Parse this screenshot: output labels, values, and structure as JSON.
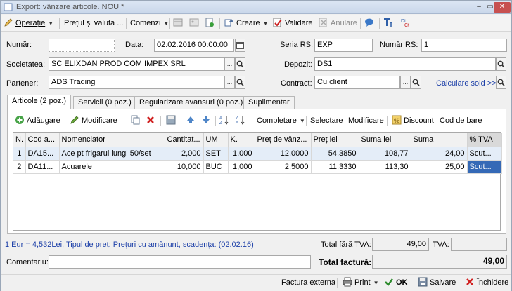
{
  "window": {
    "title": "Export: vânzare articole. NOU *",
    "min": "–",
    "max": "▭",
    "close": "✕"
  },
  "toolbar": {
    "operatie": "Operație",
    "pret_valuta": "Prețul și valuta ...",
    "comenzi": "Comenzi",
    "creare": "Creare",
    "validare": "Validare",
    "anulare": "Anulare"
  },
  "form": {
    "numar_label": "Număr:",
    "numar_value": "",
    "data_label": "Data:",
    "data_value": "02.02.2016 00:00:00",
    "seria_label": "Seria RS:",
    "seria_value": "EXP",
    "numar_rs_label": "Număr RS:",
    "numar_rs_value": "1",
    "societatea_label": "Societatea:",
    "societatea_value": "SC ELIXDAN PROD COM IMPEX SRL",
    "depozit_label": "Depozit:",
    "depozit_value": "DS1",
    "partener_label": "Partener:",
    "partener_value": "ADS Trading",
    "contract_label": "Contract:",
    "contract_value": "Cu client",
    "calculare_sold": "Calculare sold >>"
  },
  "tabs": [
    {
      "label": "Articole (2 poz.)"
    },
    {
      "label": "Servicii (0 poz.)"
    },
    {
      "label": "Regularizare avansuri (0 poz.)"
    },
    {
      "label": "Suplimentar"
    }
  ],
  "grid_toolbar": {
    "adaugare": "Adăugare",
    "modificare": "Modificare",
    "completare": "Completare",
    "selectare": "Selectare",
    "modificare2": "Modificare",
    "discount": "Discount",
    "cod_de_bare": "Cod de bare"
  },
  "grid": {
    "columns": [
      "N.",
      "Cod a...",
      "Nomenclator",
      "Cantitat...",
      "UM",
      "K.",
      "Preț de vânz...",
      "Preț lei",
      "Suma lei",
      "Suma",
      "% TVA"
    ],
    "rows": [
      {
        "n": "1",
        "cod": "DA15...",
        "nomenclator": "Ace pt frigarui lungi 50/set",
        "cantitate": "2,000",
        "um": "SET",
        "k": "1,000",
        "pret_vanzare": "12,0000",
        "pret_lei": "54,3850",
        "suma_lei": "108,77",
        "suma": "24,00",
        "tva": "Scut..."
      },
      {
        "n": "2",
        "cod": "DA11...",
        "nomenclator": "Acuarele",
        "cantitate": "10,000",
        "um": "BUC",
        "k": "1,000",
        "pret_vanzare": "2,5000",
        "pret_lei": "11,3330",
        "suma_lei": "113,30",
        "suma": "25,00",
        "tva": "Scut..."
      }
    ]
  },
  "footer": {
    "info": "1 Eur = 4,532Lei, Tipul de preț: Prețuri cu amănunt, scadența:  (02.02.16)",
    "total_fara_tva_label": "Total fără TVA:",
    "total_fara_tva_value": "49,00",
    "tva_label": "TVA:",
    "tva_value": "",
    "comentariu_label": "Comentariu:",
    "comentariu_value": "",
    "total_factura_label": "Total factură:",
    "total_factura_value": "49,00"
  },
  "bottom": {
    "factura_externa": "Factura externa",
    "print": "Print",
    "ok": "OK",
    "salvare": "Salvare",
    "inchidere": "Închidere"
  },
  "colors": {
    "accent": "#3569b6",
    "link": "#1c3fa8",
    "close": "#c75050",
    "ok": "#2e8b2e",
    "cancel": "#d02020"
  }
}
